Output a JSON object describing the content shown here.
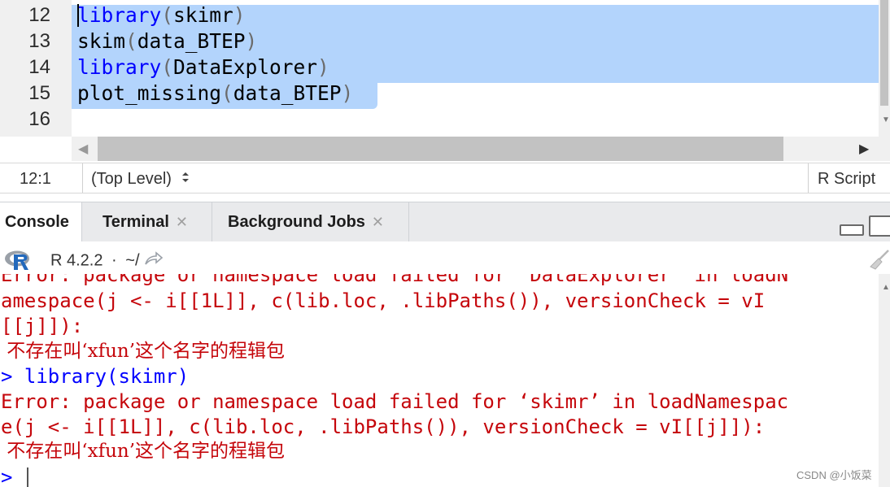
{
  "editor": {
    "line_numbers": [
      "12",
      "13",
      "14",
      "15",
      "16"
    ],
    "lines": [
      {
        "fn": "library",
        "open": "(",
        "arg": "skimr",
        "close": ")",
        "fn_is_keyword": true
      },
      {
        "fn": "skim",
        "open": "(",
        "arg": "data_BTEP",
        "close": ")",
        "fn_is_keyword": false
      },
      {
        "fn": "library",
        "open": "(",
        "arg": "DataExplorer",
        "close": ")",
        "fn_is_keyword": true
      },
      {
        "fn": "plot_missing",
        "open": "(",
        "arg": "data_BTEP",
        "close": ")",
        "fn_is_keyword": false
      }
    ],
    "selection_color": "#b3d4fc"
  },
  "status_bar": {
    "cursor_position": "12:1",
    "scope": "(Top Level)",
    "scope_icon": "updown-icon",
    "file_type": "R Script"
  },
  "tabs": [
    {
      "label": "Console",
      "active": true,
      "closable": false
    },
    {
      "label": "Terminal",
      "active": false,
      "closable": true
    },
    {
      "label": "Background Jobs",
      "active": false,
      "closable": true
    }
  ],
  "console_header": {
    "r_version": "R 4.2.2",
    "separator": "·",
    "working_dir": "~/"
  },
  "console_lines": [
    {
      "kind": "err",
      "text": "Error: package or namespace load failed for ‘DataExplorer’ in loadN"
    },
    {
      "kind": "err",
      "text": "amespace(j <- i[[1L]], c(lib.loc, .libPaths()), versionCheck = vI"
    },
    {
      "kind": "err",
      "text": "[[j]]):"
    },
    {
      "kind": "msg",
      "text": " 不存在叫‘xfun’这个名字的程辑包"
    },
    {
      "kind": "cmd",
      "text": "> library(skimr)"
    },
    {
      "kind": "err",
      "text": "Error: package or namespace load failed for ‘skimr’ in loadNamespac"
    },
    {
      "kind": "err",
      "text": "e(j <- i[[1L]], c(lib.loc, .libPaths()), versionCheck = vI[[j]]):"
    },
    {
      "kind": "msg",
      "text": " 不存在叫‘xfun’这个名字的程辑包"
    },
    {
      "kind": "cmd",
      "text": ">"
    }
  ],
  "watermark": "CSDN @小饭菜",
  "colors": {
    "error": "#c5060b",
    "command": "#0000ff",
    "keyword": "#0000ff"
  }
}
